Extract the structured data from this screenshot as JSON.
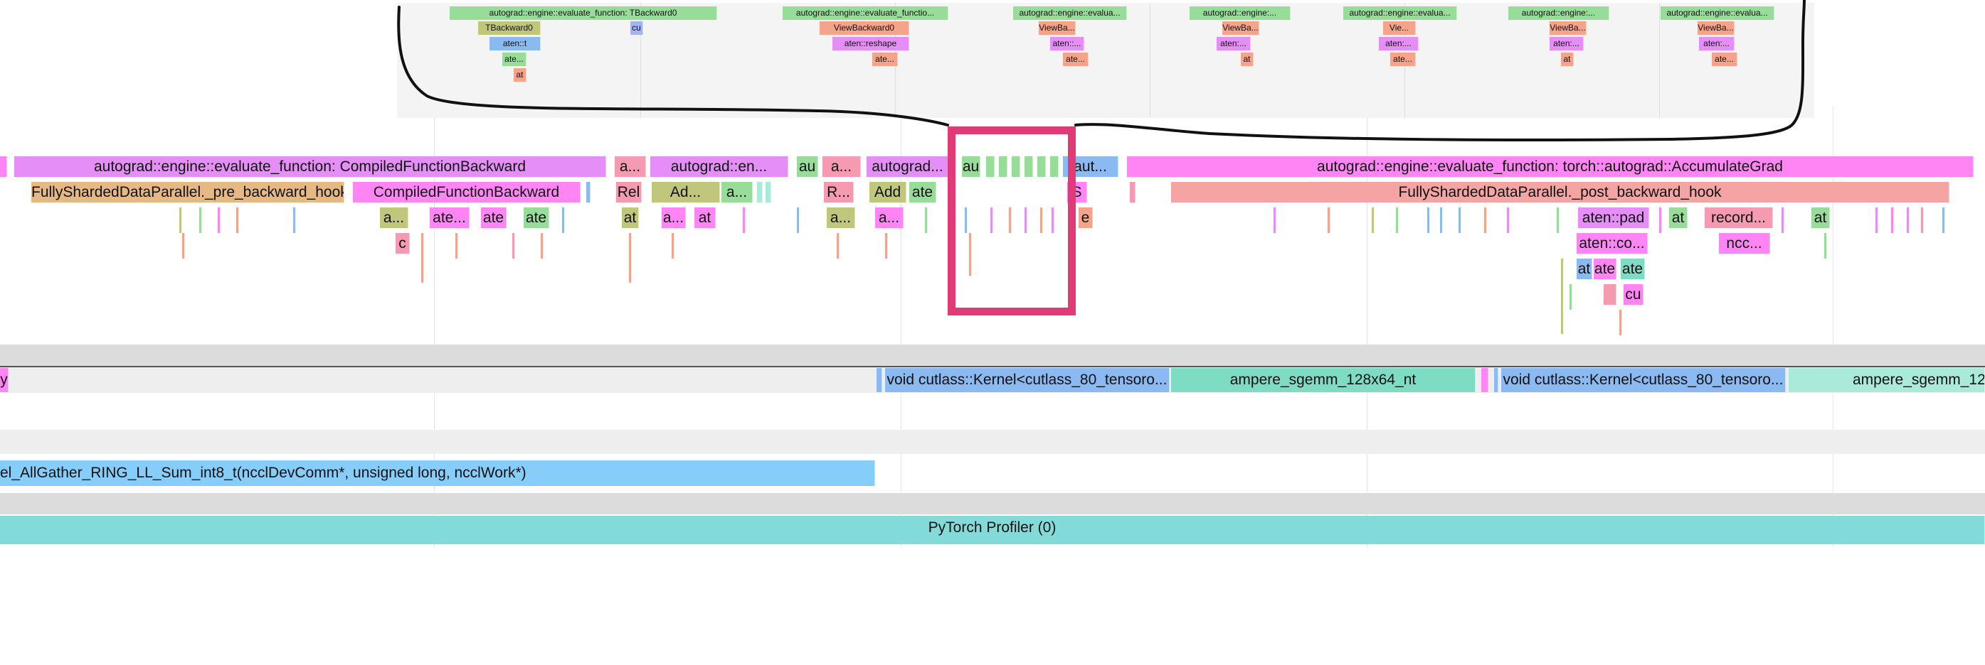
{
  "inset": {
    "row0": [
      "autograd::engine::evaluate_function: TBackward0",
      "autograd::engine::evaluate_functio...",
      "autograd::engine::evalua...",
      "autograd::engine:...",
      "autograd::engine::evalua...",
      "autograd::engine:...",
      "autograd::engine::evalua..."
    ],
    "row1": [
      "TBackward0",
      "cu",
      "ViewBackward0",
      "ViewBa...",
      "ViewBa...",
      "Vie...",
      "ViewBa...",
      "ViewBa..."
    ],
    "row2": [
      "aten::t",
      "aten::reshape",
      "aten::...",
      "aten:...",
      "aten:...",
      "aten:...",
      "aten:..."
    ],
    "row3": [
      "ate...",
      "ate...",
      "ate...",
      "at",
      "ate...",
      "at",
      "ate..."
    ],
    "row4": [
      "at"
    ]
  },
  "cpu": {
    "row0": [
      "autograd::engine::evaluate_function: CompiledFunctionBackward",
      "a...",
      "autograd::en...",
      "au",
      "a...",
      "autograd...",
      "au",
      "aut...",
      "autograd::engine::evaluate_function: torch::autograd::AccumulateGrad"
    ],
    "row1": [
      "FullyShardedDataParallel._pre_backward_hook",
      "CompiledFunctionBackward",
      "Rel",
      "Ad...",
      "a...",
      "R...",
      "Add",
      "ate",
      "S",
      "FullyShardedDataParallel._post_backward_hook"
    ],
    "row2": [
      "a...",
      "ate...",
      "ate",
      "ate",
      "at",
      "a...",
      "at",
      "a...",
      "a...",
      "e",
      "aten::pad",
      "at",
      "record...",
      "at"
    ],
    "row3": [
      "c",
      "aten::co...",
      "ncc..."
    ],
    "row4": [
      "at",
      "ate",
      "ate"
    ],
    "row5": [
      "cu"
    ]
  },
  "gpu": {
    "kernels": [
      "void cutlass::Kernel<cutlass_80_tensoro...",
      "ampere_sgemm_128x64_nt",
      "void cutlass::Kernel<cutlass_80_tensoro...",
      "ampere_sgemm_128"
    ],
    "left_label": "y",
    "nccl": "el_AllGather_RING_LL_Sum_int8_t(ncclDevComm*, unsigned long, ncclWork*)",
    "profiler": "PyTorch Profiler (0)"
  },
  "colors": {
    "green": "#98dc9a",
    "salmon": "#f5a38b",
    "lavender": "#a7b2f2",
    "violet": "#e58ef7",
    "blue": "#8bbaf2",
    "magenta": "#ff85f5",
    "pink": "#f59ab0",
    "olive": "#c1c67d",
    "tan": "#e5b884",
    "teal": "#7fdcc4",
    "lightteal": "#a9eadb",
    "sky": "#87cdfa",
    "profiler": "#82dbd9",
    "highlight": "#e03a77"
  }
}
